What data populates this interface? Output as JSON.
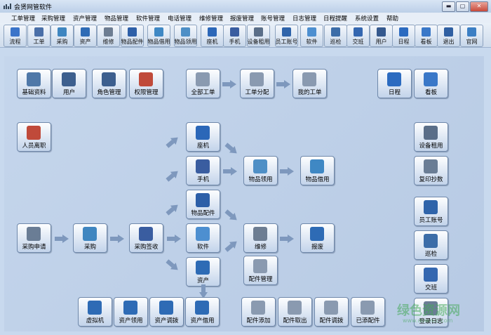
{
  "app": {
    "title": "会贤网管软件"
  },
  "window_buttons": {
    "minimize": "▬",
    "maximize": "▢",
    "close": "✕"
  },
  "menu": [
    "工单管理",
    "采购管理",
    "资产管理",
    "物品管理",
    "软件管理",
    "电话管理",
    "维修管理",
    "报废管理",
    "账号管理",
    "日志管理",
    "日程提醒",
    "系统设置",
    "帮助"
  ],
  "toolbar": [
    {
      "label": "流程",
      "color": "#3b74c9"
    },
    {
      "label": "工单",
      "color": "#4a6fa8"
    },
    {
      "label": "采购",
      "color": "#3f86c0"
    },
    {
      "label": "资产",
      "color": "#2e6bb5"
    },
    {
      "label": "维修",
      "color": "#6d7d92"
    },
    {
      "label": "物品配件",
      "color": "#2d5fa8"
    },
    {
      "label": "物品借用",
      "color": "#3f88c4"
    },
    {
      "label": "物品领用",
      "color": "#4e8fc6"
    },
    {
      "label": "座机",
      "color": "#2b67b8"
    },
    {
      "label": "手机",
      "color": "#3a5da0"
    },
    {
      "label": "设备租用",
      "color": "#5a6e88"
    },
    {
      "label": "员工账号",
      "color": "#2f64aa"
    },
    {
      "label": "软件",
      "color": "#4d8fd0"
    },
    {
      "label": "巡检",
      "color": "#3c6da8"
    },
    {
      "label": "交班",
      "color": "#3467b0"
    },
    {
      "label": "用户",
      "color": "#35598e"
    },
    {
      "label": "日程",
      "color": "#2c6bc0"
    },
    {
      "label": "看板",
      "color": "#3a78c8"
    },
    {
      "label": "退出",
      "color": "#2f5fa2"
    },
    {
      "label": "官网",
      "color": "#3c7fc4"
    }
  ],
  "nodes": {
    "basic_data": {
      "label": "基础资料",
      "color": "#4f78a8"
    },
    "user": {
      "label": "用户",
      "color": "#3d5f8e"
    },
    "role_manage": {
      "label": "角色管理",
      "color": "#3d5f8e"
    },
    "permission_manage": {
      "label": "权限管理",
      "color": "#c04a3a"
    },
    "all_orders": {
      "label": "全部工单",
      "color": "#8a9ab0"
    },
    "order_assign": {
      "label": "工单分配",
      "color": "#8a9ab0"
    },
    "my_orders": {
      "label": "我的工单",
      "color": "#8a9ab0"
    },
    "schedule": {
      "label": "日程",
      "color": "#2c6bc0"
    },
    "kanban": {
      "label": "看板",
      "color": "#3a78c8"
    },
    "staff_leave": {
      "label": "人员离职",
      "color": "#c04a3a"
    },
    "landline": {
      "label": "座机",
      "color": "#2b67b8"
    },
    "mobile": {
      "label": "手机",
      "color": "#3a5da0"
    },
    "goods_parts": {
      "label": "物品配件",
      "color": "#2d5fa8"
    },
    "goods_use": {
      "label": "物品领用",
      "color": "#4e8fc6"
    },
    "goods_borrow": {
      "label": "物品借用",
      "color": "#3f88c4"
    },
    "equip_rent": {
      "label": "设备租用",
      "color": "#5a6e88"
    },
    "copy_print": {
      "label": "复印抄数",
      "color": "#6a7d95"
    },
    "purchase_request": {
      "label": "采购申请",
      "color": "#6a7d95"
    },
    "purchase": {
      "label": "采购",
      "color": "#3f86c0"
    },
    "purchase_receive": {
      "label": "采购签收",
      "color": "#3a5da0"
    },
    "software": {
      "label": "软件",
      "color": "#4d8fd0"
    },
    "repair": {
      "label": "维修",
      "color": "#6d7d92"
    },
    "scrap": {
      "label": "报废",
      "color": "#2e6bb5"
    },
    "staff_account": {
      "label": "员工账号",
      "color": "#2f64aa"
    },
    "patrol": {
      "label": "巡检",
      "color": "#3c6da8"
    },
    "handover": {
      "label": "交班",
      "color": "#3467b0"
    },
    "asset": {
      "label": "资产",
      "color": "#2e6bb5"
    },
    "parts_manage": {
      "label": "配件管理",
      "color": "#8a9ab0"
    },
    "virtual_machine": {
      "label": "虚拟机",
      "color": "#2e6bb5"
    },
    "asset_use": {
      "label": "资产领用",
      "color": "#2e6bb5"
    },
    "asset_transfer": {
      "label": "资产调拨",
      "color": "#2e6bb5"
    },
    "asset_borrow": {
      "label": "资产借用",
      "color": "#2e6bb5"
    },
    "parts_add": {
      "label": "配件添加",
      "color": "#8a9ab0"
    },
    "parts_out": {
      "label": "配件取出",
      "color": "#8a9ab0"
    },
    "parts_transfer": {
      "label": "配件调拨",
      "color": "#8a9ab0"
    },
    "parts_added": {
      "label": "已添配件",
      "color": "#8a9ab0"
    },
    "login_log": {
      "label": "登录日志",
      "color": "#6a7d95"
    }
  },
  "watermark": {
    "main": "绿色资源网",
    "sub": "www.downcc.com"
  }
}
